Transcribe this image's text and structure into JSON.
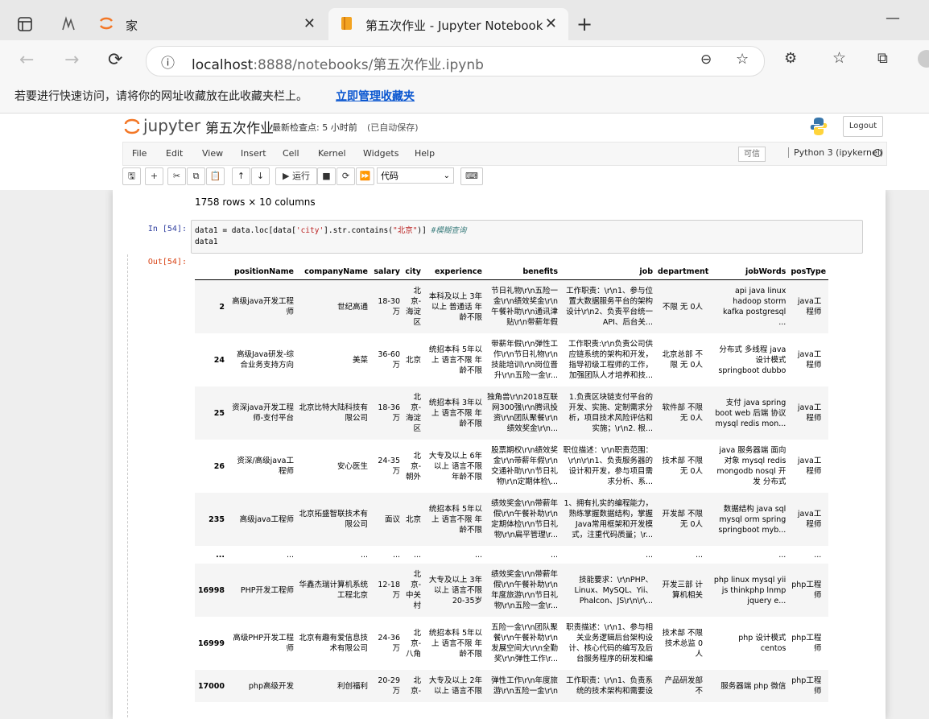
{
  "browser": {
    "tabs": [
      {
        "title": "家",
        "active": false
      },
      {
        "title": "第五次作业 - Jupyter Notebook",
        "active": true
      }
    ],
    "url_host": "localhost",
    "url_path": ":8888/notebooks/第五次作业.ipynb",
    "favorites_msg": "若要进行快速访问，请将你的网址收藏放在此收藏夹栏上。",
    "favorites_link": "立即管理收藏夹"
  },
  "jupyter": {
    "logo": "jupyter",
    "notebook_name": "第五次作业",
    "checkpoint": "最新检查点: 5 小时前",
    "autosave": "(已自动保存)",
    "logout": "Logout",
    "menus": [
      "File",
      "Edit",
      "View",
      "Insert",
      "Cell",
      "Kernel",
      "Widgets",
      "Help"
    ],
    "trusted": "可信",
    "kernel": "Python 3 (ipykernel)",
    "run_label": "运行",
    "cell_type": "代码"
  },
  "notebook": {
    "rows_cols": "1758 rows × 10 columns",
    "in_prompt": "In  [54]:",
    "out_prompt": "Out[54]:",
    "code_line1_a": "data1 = data.loc[data[",
    "code_line1_str1": "'city'",
    "code_line1_b": "].str.contains(",
    "code_line1_str2": "\"北京\"",
    "code_line1_c": ")] ",
    "code_line1_cmt": "#模糊查询",
    "code_line2": "data1"
  },
  "table": {
    "headers": [
      "",
      "positionName",
      "companyName",
      "salary",
      "city",
      "experience",
      "benefits",
      "job",
      "department",
      "jobWords",
      "posType"
    ],
    "rows": [
      [
        "2",
        "高级java开发工程师",
        "世纪高通",
        "18-30万",
        "北京-海淀区",
        "本科及以上 3年以上 普通话 年龄不限",
        "节日礼物\\r\\n五险一金\\r\\n绩效奖金\\r\\n午餐补助\\r\\n通讯津贴\\r\\n带薪年假",
        "工作职责：\\r\\n1、参与位置大数据服务平台的架构设计\\r\\n2、负责平台统一API、后台关...",
        "不限 无 0人",
        "api java linux hadoop storm kafka postgresql ...",
        "java工程师"
      ],
      [
        "24",
        "高级Java研发-综合业务支持方向",
        "美菜",
        "36-60万",
        "北京",
        "统招本科 5年以上 语言不限 年龄不限",
        "带薪年假\\r\\n弹性工作\\r\\n节日礼物\\r\\n技能培训\\r\\n岗位晋升\\r\\n五险一金\\r...",
        "工作职责:\\r\\n负责公司供应链系统的架构和开发，指导初级工程师的工作，加强团队人才培养和技...",
        "北京总部 不限 无 0人",
        "分布式 多线程 java 设计模式 springboot dubbo",
        "java工程师"
      ],
      [
        "25",
        "资深java开发工程师-支付平台",
        "北京比特大陆科技有限公司",
        "18-36万",
        "北京-海淀区",
        "统招本科 3年以上 语言不限 年龄不限",
        "独角兽\\r\\n2018互联网300强\\r\\n腾讯投资\\r\\n团队聚餐\\r\\n绩效奖金\\r\\n...",
        "1.负责区块链支付平台的开发、实施、定制需求分析，项目技术风险评估和实施；\\r\\n2. 根...",
        "软件部 不限 无 0人",
        "支付 java spring boot web 后端 协议 mysql redis mon...",
        "java工程师"
      ],
      [
        "26",
        "资深/高级java工程师",
        "安心医生",
        "24-35万",
        "北京-朝外",
        "大专及以上 6年以上 语言不限 年龄不限",
        "股票期权\\r\\n绩效奖金\\r\\n带薪年假\\r\\n交通补助\\r\\n节日礼物\\r\\n定期体检\\...",
        "职位描述：\\r\\n职责范围：\\r\\n\\r\\n1、负责服务器的设计和开发，参与项目需求分析、系...",
        "技术部 不限 无 0人",
        "java 服务器端 面向对象 mysql redis mongodb nosql 开发 分布式",
        "java工程师"
      ],
      [
        "235",
        "高级java工程师",
        "北京拓盛智联技术有限公司",
        "面议",
        "北京",
        "统招本科 5年以上 语言不限 年龄不限",
        "绩效奖金\\r\\n带薪年假\\r\\n午餐补助\\r\\n定期体检\\r\\n节日礼物\\r\\n扁平管理\\r...",
        "1、拥有扎实的编程能力，熟练掌握数据结构，掌握Java常用框架和开发模式，注重代码质量；\\r...",
        "开发部 不限 无 0人",
        "数据结构 java sql mysql orm spring springboot myb...",
        "java工程师"
      ],
      [
        "...",
        "...",
        "...",
        "...",
        "...",
        "...",
        "...",
        "...",
        "...",
        "...",
        "..."
      ],
      [
        "16998",
        "PHP开发工程师",
        "华鑫杰瑞计算机系统工程北京",
        "12-18万",
        "北京-中关村",
        "大专及以上 3年以上 语言不限 20-35岁",
        "绩效奖金\\r\\n带薪年假\\r\\n午餐补助\\r\\n年度旅游\\r\\n节日礼物\\r\\n五险一金\\r...",
        "技能要求：\\r\\nPHP、Linux、MySQL、Yii、Phalcon、JS\\r\\n\\r\\...",
        "开发三部 计算机相关",
        "php linux mysql yii js thinkphp lnmp jquery e...",
        "php工程师"
      ],
      [
        "16999",
        "高级PHP开发工程师",
        "北京有趣有爱信息技术有限公司",
        "24-36万",
        "北京-八角",
        "统招本科 5年以上 语言不限 年龄不限",
        "五险一金\\r\\n团队聚餐\\r\\n午餐补助\\r\\n发展空间大\\r\\n全勤奖\\r\\n弹性工作\\r...",
        "职责描述：\\r\\n1、参与相关业务逻辑后台架构设计、核心代码的编写及后台服务程序的研发和编写...",
        "技术部 不限 技术总监 0人",
        "php 设计模式 centos",
        "php工程师"
      ],
      [
        "17000",
        "php高级开发",
        "利创福利",
        "20-29万",
        "北京-",
        "大专及以上 2年以上 语言不限",
        "弹性工作\\r\\n年度旅游\\r\\n五险一金\\r\\n",
        "工作职责：\\r\\n1、负责系统的技术架构和需要设",
        "产品研发部 不",
        "服务器端 php 微信",
        "php工程师"
      ]
    ]
  },
  "colors": {
    "jupyter_orange": "#f37726",
    "in_prompt": "#303f9f",
    "out_prompt": "#d84315",
    "link": "#0b57d0"
  }
}
